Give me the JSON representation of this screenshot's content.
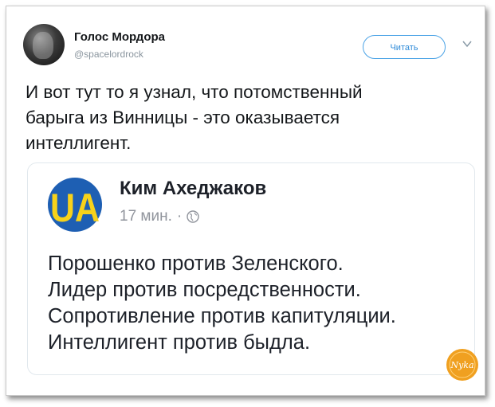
{
  "tweet": {
    "display_name": "Голос Мордора",
    "handle": "@spacelordrock",
    "follow_label": "Читать",
    "text": "И вот тут то я узнал, что потомственный\nбарыга из Винницы - это оказывается\nинтеллигент."
  },
  "quoted_post": {
    "logo_text": "UA",
    "author": "Ким Ахеджаков",
    "time": "17 мин.",
    "separator": "·",
    "lines": [
      "Порошенко против Зеленского.",
      "Лидер против посредственности.",
      "Сопротивление против капитуляции.",
      "Интеллигент против быдла."
    ]
  },
  "watermark": {
    "text": "Nyka"
  },
  "colors": {
    "follow_border": "#4ba3e6",
    "logo_blue": "#1e5fb3",
    "logo_yellow": "#f7d21a",
    "watermark_orange": "#f0a020"
  }
}
